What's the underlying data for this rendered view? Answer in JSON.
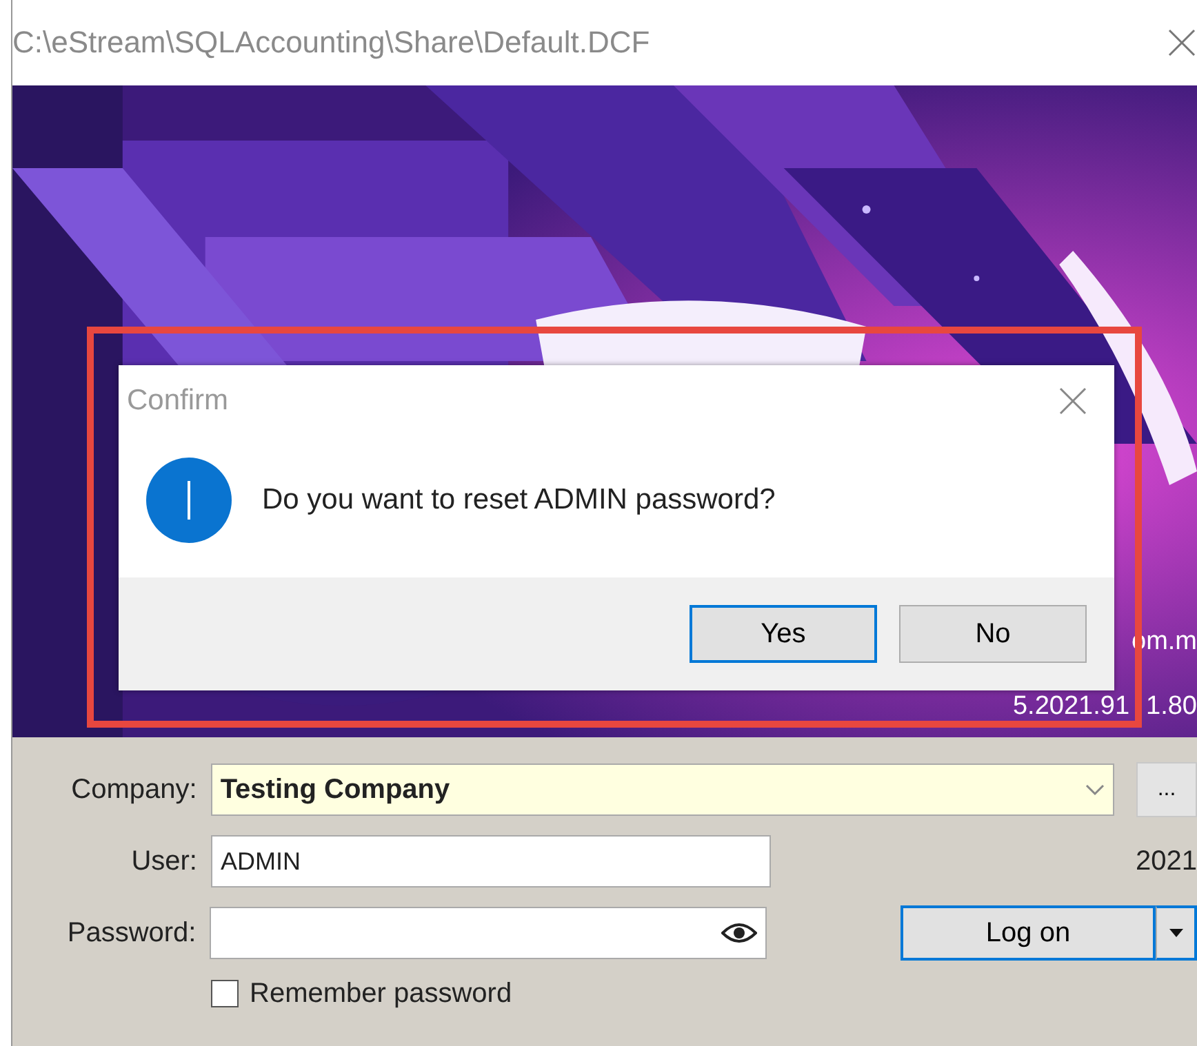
{
  "window": {
    "title": "C:\\eStream\\SQLAccounting\\Share\\Default.DCF"
  },
  "banner": {
    "kind": "picture",
    "website": "om.m",
    "version_parts": [
      "5.2021.91",
      "1.80"
    ]
  },
  "dialog": {
    "title": "Confirm",
    "message": "Do you want to reset ADMIN password?",
    "buttons": [
      {
        "label": "Yes",
        "focused": true
      },
      {
        "label": "No",
        "focused": false
      }
    ]
  },
  "form": {
    "company": {
      "label": "Company:",
      "value": "Testing Company"
    },
    "browse_button": "...",
    "user": {
      "label": "User:",
      "value": "ADMIN"
    },
    "year": "2021",
    "password": {
      "label": "Password:"
    },
    "logon_button": {
      "label": "Log on",
      "focused": true
    },
    "remember": {
      "label": "Remember password",
      "checked": false
    }
  }
}
